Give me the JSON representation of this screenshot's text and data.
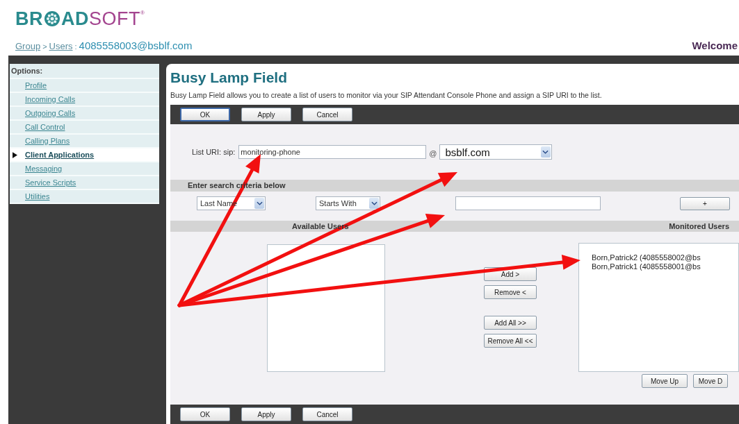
{
  "logo": {
    "lead": "BR",
    "middle": "AD",
    "tail": "SOFT",
    "mark": "®"
  },
  "breadcrumb": [
    {
      "text": "Group",
      "kind": "link"
    },
    {
      "text": ">",
      "kind": "sep"
    },
    {
      "text": "Users",
      "kind": "link"
    },
    {
      "text": ":",
      "kind": "sep"
    },
    {
      "text": "4085558003@bsblf.com",
      "kind": "current"
    }
  ],
  "welcome": "Welcome",
  "sidebar": {
    "heading": "Options:",
    "items": [
      {
        "label": "Profile",
        "selected": false
      },
      {
        "label": "Incoming Calls",
        "selected": false
      },
      {
        "label": "Outgoing Calls",
        "selected": false
      },
      {
        "label": "Call Control",
        "selected": false
      },
      {
        "label": "Calling Plans",
        "selected": false
      },
      {
        "label": "Client Applications",
        "selected": true
      },
      {
        "label": "Messaging",
        "selected": false
      },
      {
        "label": "Service Scripts",
        "selected": false
      },
      {
        "label": "Utilities",
        "selected": false
      }
    ]
  },
  "page": {
    "title": "Busy Lamp Field",
    "description": "Busy Lamp Field allows you to create a list of users to monitor via your SIP Attendant Console Phone and assign a SIP URI to the list."
  },
  "top_buttons": [
    {
      "label": "OK",
      "selected": true
    },
    {
      "label": "Apply",
      "selected": false
    },
    {
      "label": "Cancel",
      "selected": false
    }
  ],
  "list_uri": {
    "label": "List URI: sip:",
    "value": "monitoring-phone",
    "at": "@",
    "domain": "bsblf.com"
  },
  "search": {
    "heading": "Enter search criteria below",
    "field": "Last Name",
    "mode": "Starts With",
    "button": "+"
  },
  "users": {
    "available_heading": "Available Users",
    "monitored_heading": "Monitored Users",
    "monitored": [
      "Born,Patrick2 (4085558002@bs",
      "Born,Patrick1 (4085558001@bs"
    ],
    "move_buttons": [
      "Add >",
      "Remove <",
      "Add All >>",
      "Remove All <<"
    ],
    "order_buttons": [
      "Move Up",
      "Move D"
    ]
  },
  "bottom_buttons": [
    {
      "label": "OK",
      "selected": false
    },
    {
      "label": "Apply",
      "selected": false
    },
    {
      "label": "Cancel",
      "selected": false
    }
  ]
}
